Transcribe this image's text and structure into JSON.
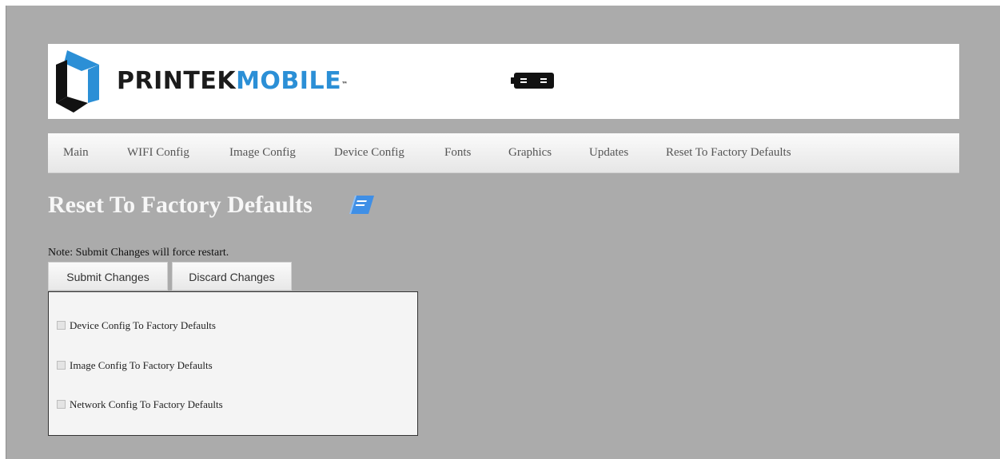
{
  "brand": {
    "part1": "PRINTEK",
    "part2": "MOBILE",
    "trademark": "™"
  },
  "colors": {
    "background": "#ababab",
    "brand_blue": "#2b8fd6",
    "title": "#f7f7f7"
  },
  "nav": {
    "items": [
      {
        "label": "Main"
      },
      {
        "label": "WIFI Config"
      },
      {
        "label": "Image Config"
      },
      {
        "label": "Device Config"
      },
      {
        "label": "Fonts"
      },
      {
        "label": "Graphics"
      },
      {
        "label": "Updates"
      },
      {
        "label": "Reset To Factory Defaults"
      }
    ]
  },
  "page": {
    "title": "Reset To Factory Defaults",
    "title_icon": "book-icon"
  },
  "note": "Note: Submit Changes will force restart.",
  "buttons": {
    "submit": "Submit Changes",
    "discard": "Discard Changes"
  },
  "options": [
    {
      "label": "Device Config To Factory Defaults",
      "checked": false
    },
    {
      "label": "Image Config To Factory Defaults",
      "checked": false
    },
    {
      "label": "Network Config To Factory Defaults",
      "checked": false
    }
  ],
  "icons": {
    "logo": "printek-logo-icon",
    "battery": "battery-icon"
  }
}
